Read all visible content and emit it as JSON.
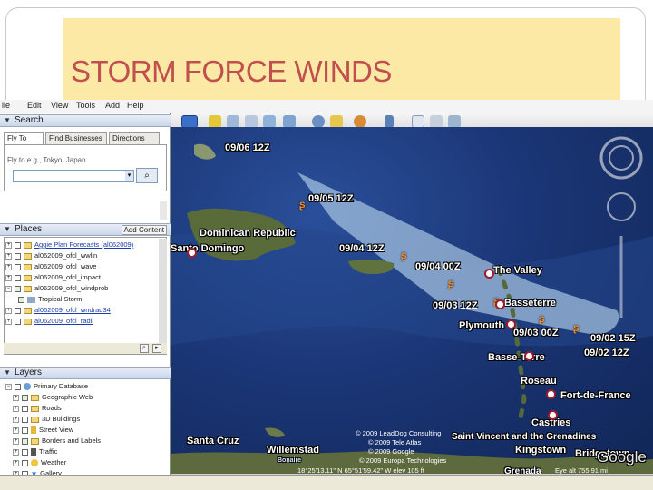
{
  "slide": {
    "title": "STORM FORCE WINDS"
  },
  "menubar": [
    "ile",
    "Edit",
    "View",
    "Tools",
    "Add",
    "Help"
  ],
  "search_panel": {
    "heading": "Search",
    "tabs": [
      "Fly To",
      "Find Businesses",
      "Directions"
    ],
    "hint": "Fly to e.g., Tokyo, Japan"
  },
  "places_panel": {
    "heading": "Places",
    "add_content": "Add Content",
    "items": [
      "Aggie Plan Forecasts (al062009)",
      "al062009_ofcl_wwlin",
      "al062009_ofcl_wave",
      "al062009_ofcl_impact",
      "al062009_ofcl_windprob",
      "Tropical Storm",
      "al062009_ofcl_wndrad34",
      "al062009_ofcl_radii"
    ]
  },
  "layers_panel": {
    "heading": "Layers",
    "items": [
      "Primary Database",
      "Geographic Web",
      "Roads",
      "3D Buildings",
      "Street View",
      "Borders and Labels",
      "Traffic",
      "Weather",
      "Gallery"
    ]
  },
  "map": {
    "forecast_points": [
      "09/06 12Z",
      "09/05 12Z",
      "09/04 12Z",
      "09/04 00Z",
      "09/03 12Z",
      "09/03 00Z",
      "09/02 15Z",
      "09/02 12Z"
    ],
    "places": [
      "Dominican Republic",
      "Santo Domingo",
      "The Valley",
      "Basseterre",
      "Plymouth",
      "Basse-Terre",
      "Roseau",
      "Fort-de-France",
      "Castries",
      "Saint Vincent and the Grenadines",
      "Kingstown",
      "Bridgetown",
      "Santa Cruz",
      "Willemstad",
      "Bonaire",
      "Grenada"
    ],
    "copyright": [
      "© 2009 LeadDog Consulting",
      "© 2009 Tele Atlas",
      "© 2009 Google",
      "© 2009 Europa Technologies"
    ],
    "logo": "Google",
    "eye_alt": "Eye alt 755.91 mi",
    "pointer": "18°25'13.11\" N   65°51'59.42\" W   elev  105 ft"
  },
  "colors": {
    "title_bg": "#fde9a6",
    "title_text": "#c0504d",
    "ocean": "#1b3676",
    "cone": "#bcd8ef",
    "star_border": "#9b1c2c"
  }
}
